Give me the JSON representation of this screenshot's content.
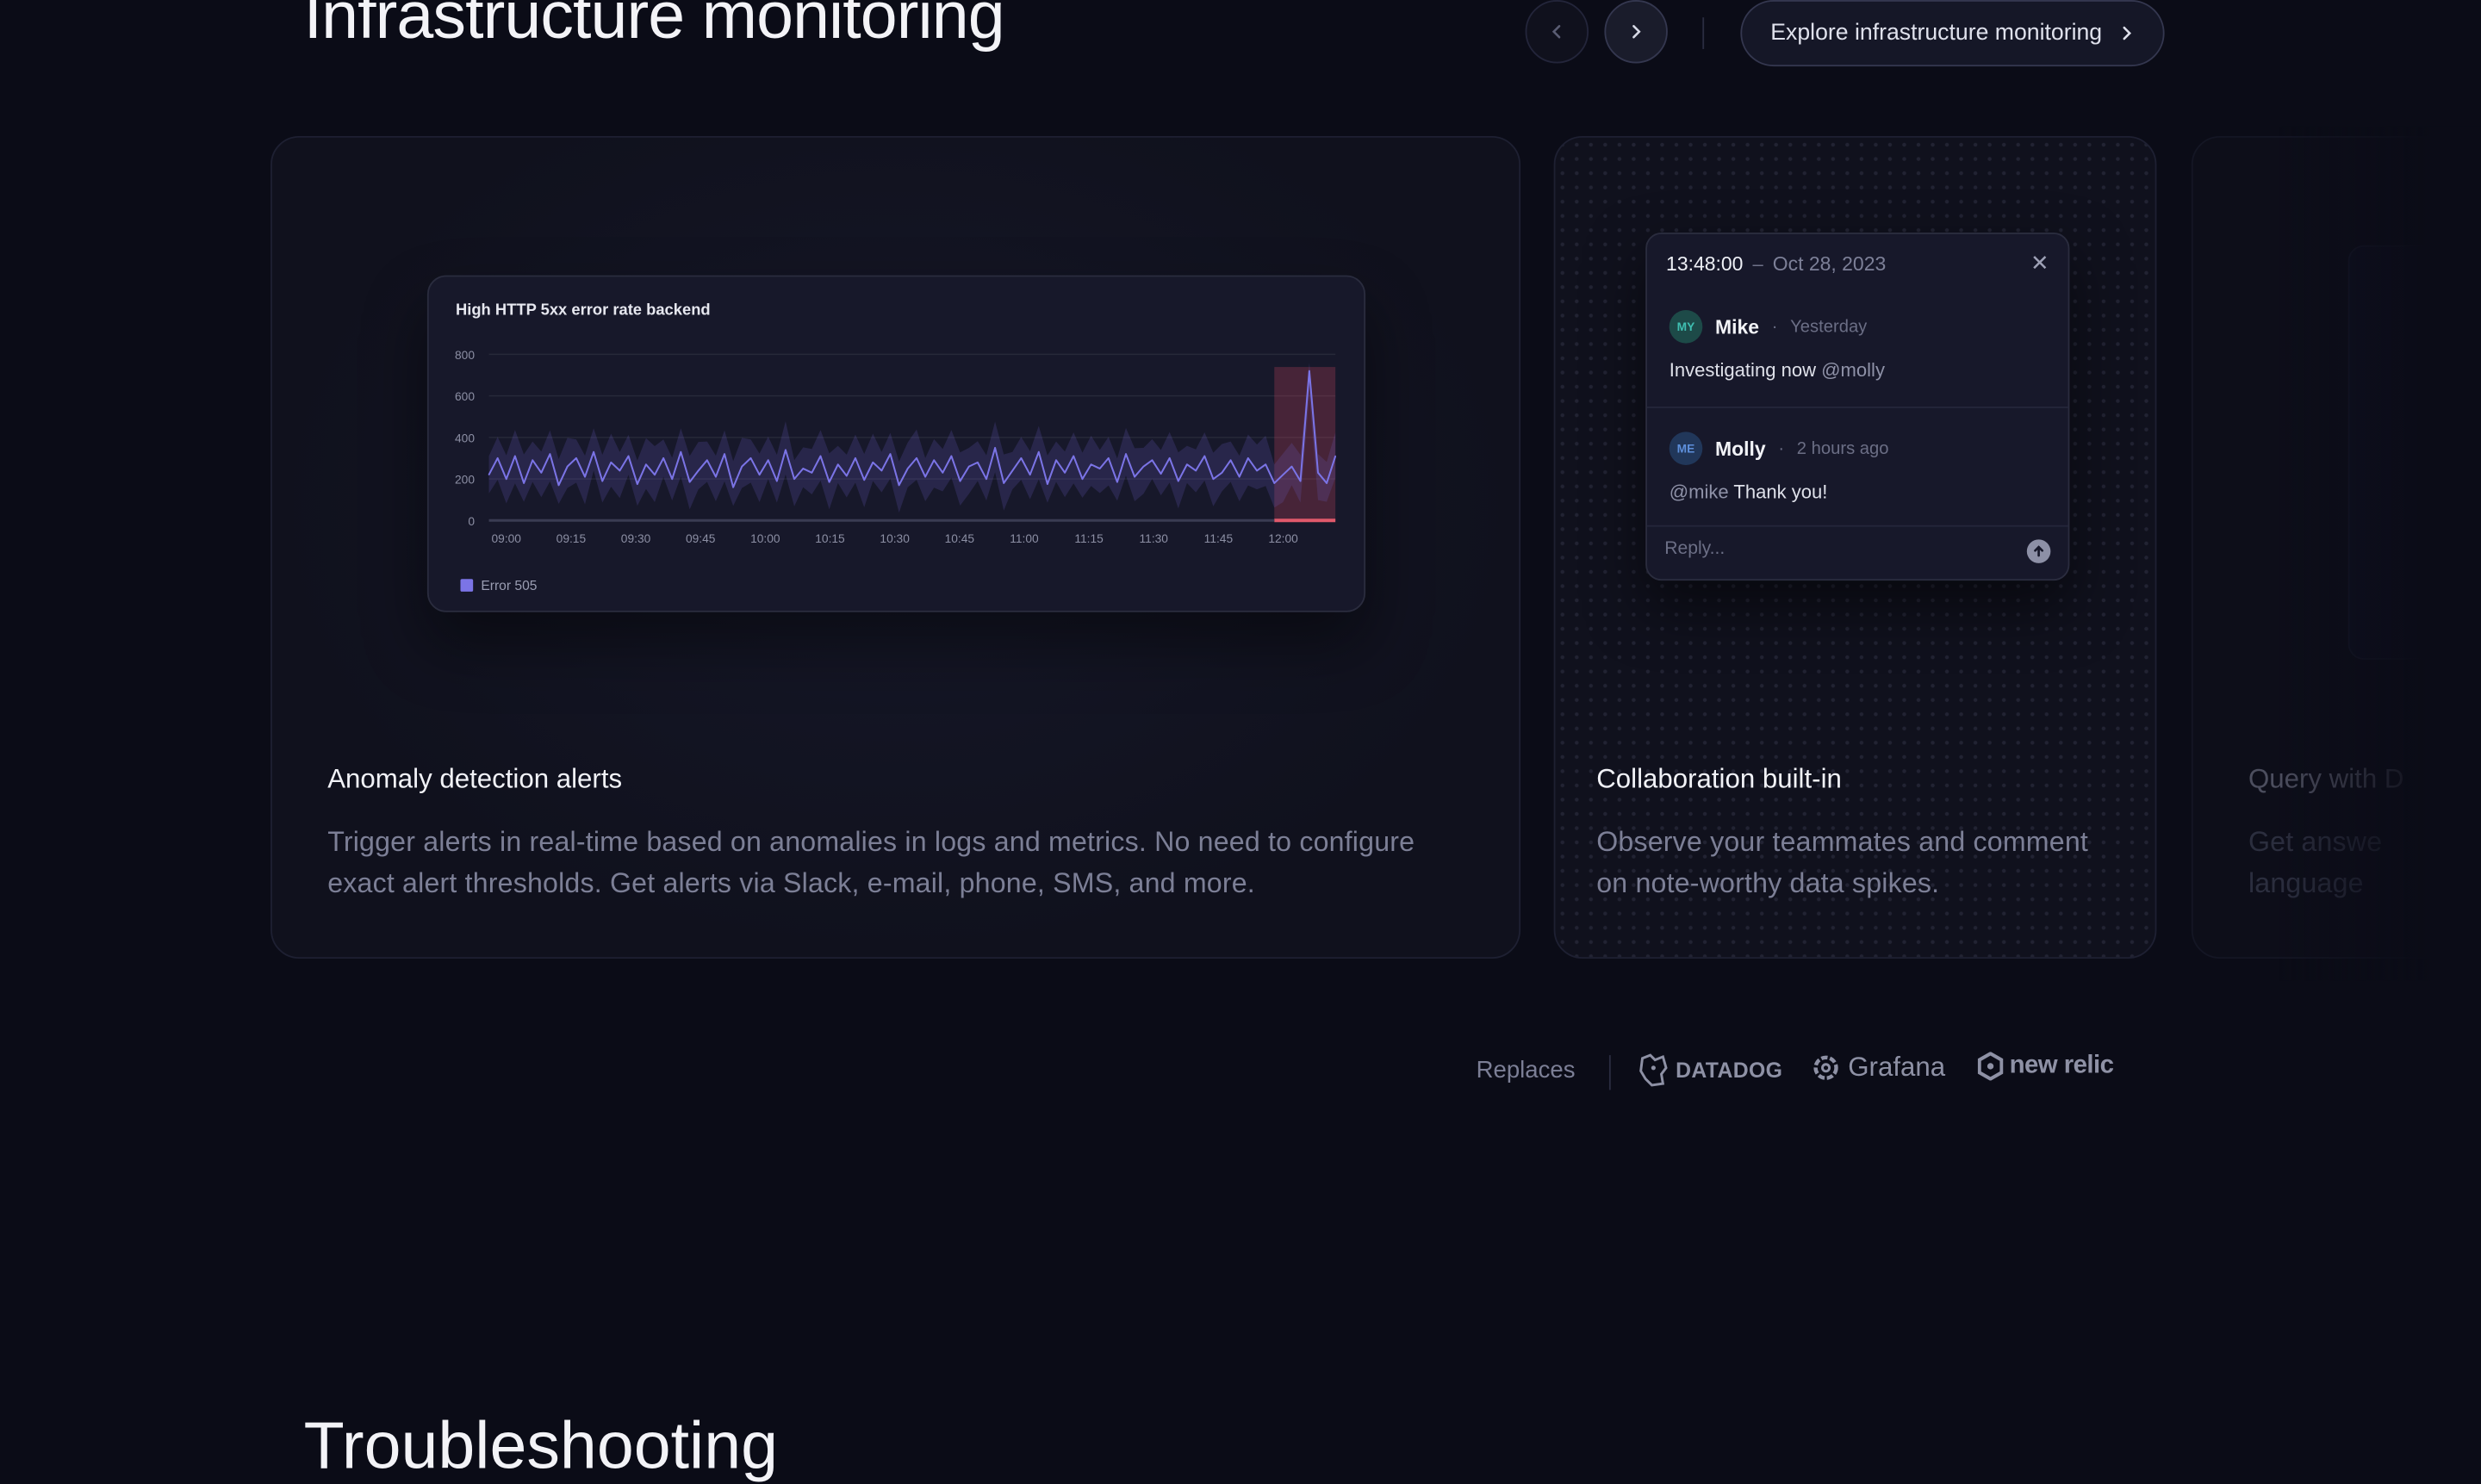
{
  "section": {
    "title": "Infrastructure monitoring",
    "explore_label": "Explore infrastructure monitoring"
  },
  "cards": [
    {
      "title": "Anomaly detection alerts",
      "description": "Trigger alerts in real-time based on anomalies in logs and metrics. No need to configure exact alert thresholds. Get alerts via Slack, e-mail, phone, SMS, and more."
    },
    {
      "title": "Collaboration built-in",
      "description": "Observe your teammates and comment on note-worthy data spikes."
    },
    {
      "title": "Query with D",
      "description": "Get answe language"
    }
  ],
  "chart": {
    "title": "High HTTP 5xx error rate backend",
    "legend": "Error 505",
    "series_color": "#7b74e6",
    "alert_color": "#e0596b"
  },
  "chart_data": {
    "type": "line",
    "title": "High HTTP 5xx error rate backend",
    "ylim": [
      0,
      800
    ],
    "yticks": [
      "800",
      "600",
      "400",
      "200",
      "0"
    ],
    "xticks": [
      "09:00",
      "09:15",
      "09:30",
      "09:45",
      "10:00",
      "10:15",
      "10:30",
      "10:45",
      "11:00",
      "11:15",
      "11:30",
      "11:45",
      "12:00"
    ],
    "series": [
      {
        "name": "Error 505",
        "values": [
          220,
          300,
          200,
          310,
          180,
          290,
          230,
          320,
          170,
          260,
          300,
          210,
          330,
          190,
          280,
          240,
          310,
          175,
          270,
          220,
          300,
          200,
          330,
          185,
          240,
          290,
          210,
          320,
          160,
          260,
          300,
          220,
          290,
          190,
          340,
          200,
          250,
          230,
          310,
          185,
          270,
          215,
          300,
          195,
          280,
          240,
          320,
          170,
          250,
          300,
          210,
          290,
          230,
          310,
          190,
          260,
          280,
          200,
          350,
          180,
          240,
          300,
          220,
          330,
          175,
          290,
          230,
          310,
          200,
          270,
          250,
          300,
          185,
          320,
          210,
          260,
          290,
          225,
          300,
          190,
          270,
          240,
          310,
          200,
          230,
          290,
          210,
          300,
          240,
          270,
          180,
          220,
          260,
          190,
          720,
          230,
          180,
          310
        ]
      }
    ]
  },
  "comments": {
    "time": "13:48:00",
    "separator": "–",
    "date": "Oct 28, 2023",
    "close_icon": "✕",
    "items": [
      {
        "initials": "MY",
        "name": "Mike",
        "dot": "·",
        "when": "Yesterday",
        "text": "Investigating now ",
        "mention": "@molly"
      },
      {
        "initials": "ME",
        "name": "Molly",
        "dot": "·",
        "when": "2 hours ago",
        "mention": "@mike",
        "text": " Thank you!"
      }
    ],
    "reply_placeholder": "Reply..."
  },
  "replaces": {
    "label": "Replaces",
    "logos": [
      "DATADOG",
      "Grafana",
      "new relic"
    ]
  },
  "bottom_heading": "Troubleshooting"
}
